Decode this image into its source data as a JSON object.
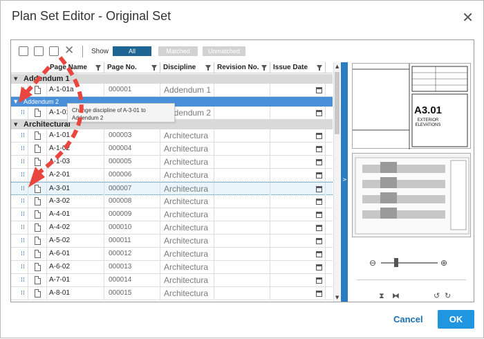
{
  "dialog": {
    "title": "Plan Set Editor - Original Set",
    "close_icon": "close-icon"
  },
  "toolbar": {
    "show_label": "Show",
    "filters": [
      "All",
      "Matched",
      "Unmatched"
    ],
    "active_filter": "All",
    "icons": [
      "add-sheet-icon",
      "expand-icon",
      "collapse-icon",
      "delete-icon"
    ]
  },
  "grid": {
    "columns": [
      "Page Name",
      "Page No.",
      "Discipline",
      "Revision No.",
      "Issue Date"
    ],
    "groups": [
      {
        "label": "Addendum 1",
        "rows": [
          {
            "page_name": "A-1-01a",
            "page_no": "000001",
            "discipline": "Addendum 1"
          }
        ]
      },
      {
        "label": "Addendum 2",
        "rows": [
          {
            "page_name": "A-1-01b",
            "page_no": "000002",
            "discipline": "Addendum 2"
          }
        ]
      },
      {
        "label": "Architectural",
        "rows": [
          {
            "page_name": "A-1-01",
            "page_no": "000003",
            "discipline": "Architectura"
          },
          {
            "page_name": "A-1-02",
            "page_no": "000004",
            "discipline": "Architectura"
          },
          {
            "page_name": "A-1-03",
            "page_no": "000005",
            "discipline": "Architectura"
          },
          {
            "page_name": "A-2-01",
            "page_no": "000006",
            "discipline": "Architectura"
          },
          {
            "page_name": "A-3-01",
            "page_no": "000007",
            "discipline": "Architectura"
          },
          {
            "page_name": "A-3-02",
            "page_no": "000008",
            "discipline": "Architectura"
          },
          {
            "page_name": "A-4-01",
            "page_no": "000009",
            "discipline": "Architectura"
          },
          {
            "page_name": "A-4-02",
            "page_no": "000010",
            "discipline": "Architectura"
          },
          {
            "page_name": "A-5-02",
            "page_no": "000011",
            "discipline": "Architectura"
          },
          {
            "page_name": "A-6-01",
            "page_no": "000012",
            "discipline": "Architectura"
          },
          {
            "page_name": "A-6-02",
            "page_no": "000013",
            "discipline": "Architectura"
          },
          {
            "page_name": "A-7-01",
            "page_no": "000014",
            "discipline": "Architectura"
          },
          {
            "page_name": "A-8-01",
            "page_no": "000015",
            "discipline": "Architectura"
          }
        ]
      }
    ],
    "tooltip": "Change discipline of A-3-01 to Addendum 2"
  },
  "preview": {
    "sheet_number": "A3.01",
    "sheet_title_line1": "EXTERIOR",
    "sheet_title_line2": "ELEVATIONS",
    "zoom_level": 0.27
  },
  "footer": {
    "cancel_label": "Cancel",
    "ok_label": "OK"
  },
  "colors": {
    "accent": "#2196e0",
    "selected_group": "#4a90d9",
    "filter_active": "#1d6693",
    "annotation": "#e8463e"
  }
}
